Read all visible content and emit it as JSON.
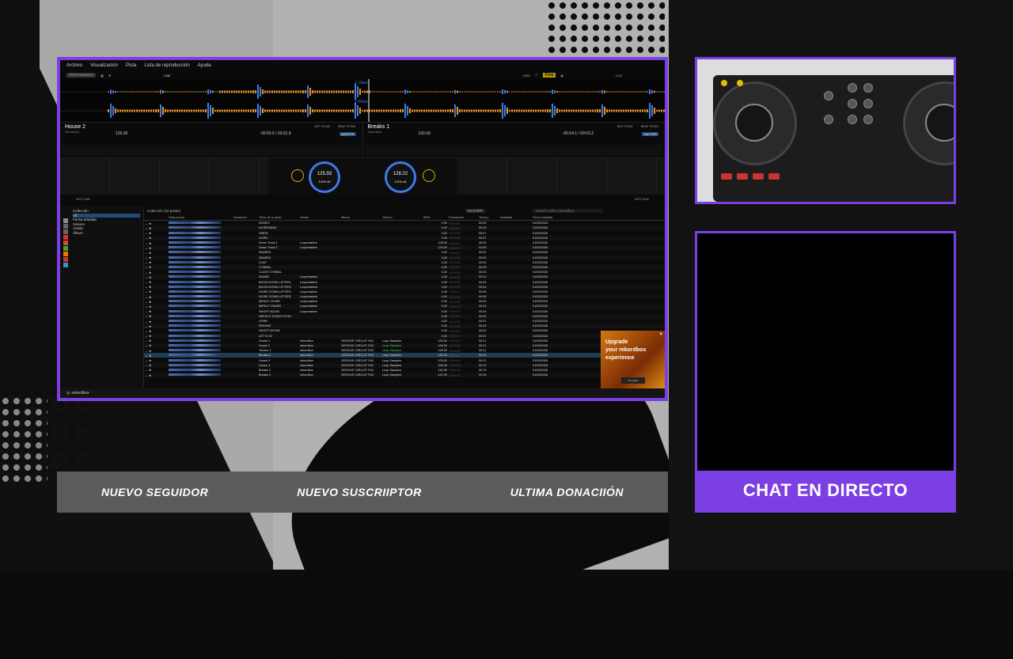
{
  "colors": {
    "accent": "#7b3fe4",
    "deck_blue": "#3d7be5",
    "waveform_orange": "#e8922a",
    "ad_orange": "#d4780f"
  },
  "rekordbox": {
    "menu": [
      "Archivo",
      "Visualización",
      "Pista",
      "Lista de reproducción",
      "Ayuda"
    ],
    "mode": "PERFORMANCE",
    "link": "LINK",
    "midi": "MIDI",
    "free_badge": "Free",
    "master_level": "2.93",
    "overview_labels": [
      "2.18ars",
      "2.46ars"
    ],
    "deck_left": {
      "title": "House 2",
      "artist": "rekordbox",
      "bpm": "126.00",
      "time": "-00:00.0 / 00:01.9",
      "key_sync": "KEY SYNC",
      "beat_sync": "BEAT SYNC",
      "master": "MASTER",
      "jog_bpm": "125.93",
      "jog_pct": "0.0% ±6"
    },
    "deck_right": {
      "title": "Breaks 1",
      "artist": "rekordbox",
      "bpm": "130.00",
      "time": "-00:04.1 / 00:03.2",
      "key_sync": "KEY SYNC",
      "beat_sync": "BEAT SYNC",
      "master": "MASTER",
      "jog_bpm": "128.22",
      "jog_pct": "0.0% ±6"
    },
    "hot_cue": "HOT CUE",
    "deck_tabs": [
      "DECK 1/2",
      "DECK 1/2",
      "DECK 3/4",
      "DECK 3/4"
    ],
    "sidebar": {
      "items": [
        "Colección",
        "All",
        "Fecha añadida",
        "Género",
        "Artista",
        "Álbum"
      ],
      "selected_index": 1
    },
    "collection_label": "Colección (32 pistas)",
    "master_select": "MASTER",
    "search_placeholder": "Search within rekordbox",
    "columns": [
      "Vista previa",
      "Ilustración",
      "Título de la pista",
      "Artista",
      "Álbum",
      "Género",
      "BPM",
      "Puntuación",
      "Tiempo",
      "Tonalidad",
      "Fecha añadida"
    ],
    "tracks": [
      {
        "title": "NOISE1",
        "artist": "",
        "album": "",
        "genre": "",
        "bpm": "0,00",
        "time": "00:09",
        "date": "01/03/2026"
      },
      {
        "title": "NOISEWAVE",
        "artist": "",
        "album": "",
        "genre": "",
        "bpm": "0,00",
        "time": "00:03",
        "date": "01/03/2026"
      },
      {
        "title": "SIREN",
        "artist": "",
        "album": "",
        "genre": "",
        "bpm": "0,00",
        "time": "00:07",
        "date": "01/03/2026"
      },
      {
        "title": "HORN",
        "artist": "",
        "album": "",
        "genre": "",
        "bpm": "0,00",
        "time": "00:07",
        "date": "01/03/2026"
      },
      {
        "title": "Demo Track 1",
        "artist": "Loopmasters",
        "album": "",
        "genre": "",
        "bpm": "128,00",
        "time": "05:02",
        "date": "01/03/2026"
      },
      {
        "title": "Demo Track 2",
        "artist": "Loopmasters",
        "album": "",
        "genre": "",
        "bpm": "120,00",
        "time": "03:56",
        "date": "01/03/2026"
      },
      {
        "title": "SNARE3",
        "artist": "",
        "album": "",
        "genre": "",
        "bpm": "0,00",
        "time": "00:02",
        "date": "01/03/2026"
      },
      {
        "title": "SNARE2",
        "artist": "",
        "album": "",
        "genre": "",
        "bpm": "0,00",
        "time": "00:02",
        "date": "01/03/2026"
      },
      {
        "title": "CLAP",
        "artist": "",
        "album": "",
        "genre": "",
        "bpm": "0,00",
        "time": "00:02",
        "date": "01/03/2026"
      },
      {
        "title": "CYMBAL",
        "artist": "",
        "album": "",
        "genre": "",
        "bpm": "0,00",
        "time": "00:03",
        "date": "01/03/2026"
      },
      {
        "title": "CLASH CYMBAL",
        "artist": "",
        "album": "",
        "genre": "",
        "bpm": "0,00",
        "time": "00:03",
        "date": "01/03/2026"
      },
      {
        "title": "SNARE",
        "artist": "Loopmasters",
        "album": "",
        "genre": "",
        "bpm": "0,00",
        "time": "00:01",
        "date": "01/03/2026"
      },
      {
        "title": "BOOM DOWN LIFTER1",
        "artist": "Loopmasters",
        "album": "",
        "genre": "",
        "bpm": "0,00",
        "time": "00:04",
        "date": "01/03/2026"
      },
      {
        "title": "BOOM DOWN LIFTER2",
        "artist": "Loopmasters",
        "album": "",
        "genre": "",
        "bpm": "0,00",
        "time": "00:04",
        "date": "01/03/2026"
      },
      {
        "title": "NOISE DOWN LIFTER1",
        "artist": "Loopmasters",
        "album": "",
        "genre": "",
        "bpm": "0,00",
        "time": "00:06",
        "date": "01/03/2026"
      },
      {
        "title": "NOISE DOWN LIFTER2",
        "artist": "Loopmasters",
        "album": "",
        "genre": "",
        "bpm": "0,00",
        "time": "00:06",
        "date": "01/03/2026"
      },
      {
        "title": "IMPACT NOISE",
        "artist": "Loopmasters",
        "album": "",
        "genre": "",
        "bpm": "0,00",
        "time": "00:05",
        "date": "01/03/2026"
      },
      {
        "title": "IMPACT SNARE",
        "artist": "Loopmasters",
        "album": "",
        "genre": "",
        "bpm": "0,00",
        "time": "00:04",
        "date": "01/03/2026"
      },
      {
        "title": "SHORT BOOM",
        "artist": "Loopmasters",
        "album": "",
        "genre": "",
        "bpm": "0,00",
        "time": "00:02",
        "date": "01/03/2026"
      },
      {
        "title": "NEEDLE SCRATCH NO",
        "artist": "",
        "album": "",
        "genre": "",
        "bpm": "0,00",
        "time": "00:02",
        "date": "01/03/2026"
      },
      {
        "title": "HORN",
        "artist": "",
        "album": "",
        "genre": "",
        "bpm": "0,00",
        "time": "00:01",
        "date": "01/03/2026"
      },
      {
        "title": "REWIND",
        "artist": "",
        "album": "",
        "genre": "",
        "bpm": "0,00",
        "time": "00:02",
        "date": "01/03/2026"
      },
      {
        "title": "SHORT BOOM!",
        "artist": "",
        "album": "",
        "genre": "",
        "bpm": "0,00",
        "time": "00:02",
        "date": "01/03/2026"
      },
      {
        "title": "LET'S GO",
        "artist": "",
        "album": "",
        "genre": "",
        "bpm": "0,00",
        "time": "00:01",
        "date": "01/03/2026"
      },
      {
        "title": "House 1",
        "artist": "rekordbox",
        "album": "GROOVE CIRCUIT FAC",
        "genre": "Loop Samples",
        "bpm": "125,00",
        "time": "00:21",
        "date": "01/03/2026"
      },
      {
        "title": "House 2",
        "artist": "rekordbox",
        "album": "GROOVE CIRCUIT FAC",
        "genre": "Loop Samples",
        "bpm": "126,00",
        "time": "00:21",
        "date": "01/03/2026"
      },
      {
        "title": "Techno 1",
        "artist": "rekordbox",
        "album": "GROOVE CIRCUIT FAC",
        "genre": "Loop Samples",
        "bpm": "128,00",
        "time": "00:21",
        "date": "01/03/2026"
      },
      {
        "title": "Breaks 1",
        "artist": "rekordbox",
        "album": "GROOVE CIRCUIT FAC",
        "genre": "Loop Samples",
        "bpm": "130,00",
        "time": "00:21",
        "date": "01/03/2026"
      },
      {
        "title": "House 3",
        "artist": "rekordbox",
        "album": "GROOVE CIRCUIT FAC",
        "genre": "Loop Samples",
        "bpm": "125,00",
        "time": "00:21",
        "date": "01/03/2026"
      },
      {
        "title": "House 4",
        "artist": "rekordbox",
        "album": "GROOVE CIRCUIT FAC",
        "genre": "Loop Samples",
        "bpm": "165,00",
        "time": "00:12",
        "date": "01/03/2026"
      },
      {
        "title": "Breaks 2",
        "artist": "rekordbox",
        "album": "GROOVE CIRCUIT FAC",
        "genre": "Loop Samples",
        "bpm": "140,00",
        "time": "00:13",
        "date": "01/03/2026"
      },
      {
        "title": "Breaks 3",
        "artist": "rekordbox",
        "album": "GROOVE CIRCUIT FAC",
        "genre": "Loop Samples",
        "bpm": "121,00",
        "time": "00:15",
        "date": "01/03/2026"
      }
    ],
    "highlight_index": 27,
    "ad": {
      "line1": "Upgrade",
      "line2": "your rekordbox",
      "line3": "experience",
      "button": "see plans"
    },
    "footer_logo": "rekordbox"
  },
  "alerts": {
    "follower": "NUEVO SEGUIDOR",
    "subscriber": "NUEVO SUSCRIIPTOR",
    "donation": "ULTIMA DONACIIÓN"
  },
  "chat": {
    "label": "CHAT EN DIRECTO"
  }
}
